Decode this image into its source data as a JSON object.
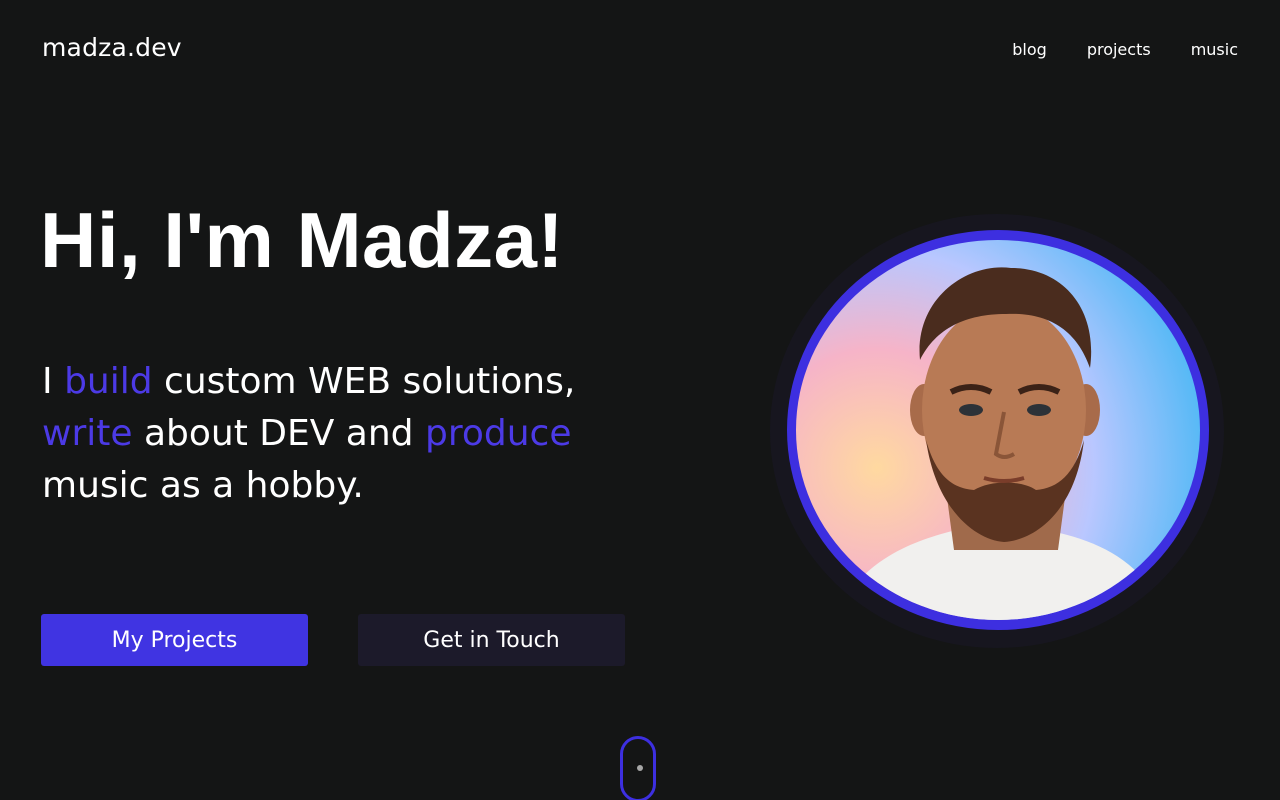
{
  "header": {
    "logo": "madza.dev",
    "nav": [
      {
        "label": "blog"
      },
      {
        "label": "projects"
      },
      {
        "label": "music"
      }
    ]
  },
  "hero": {
    "title": "Hi, I'm Madza!",
    "text": {
      "part1": "I ",
      "highlight1": "build",
      "part2": " custom WEB solutions, ",
      "highlight2": "write",
      "part3": " about DEV and ",
      "highlight3": "produce",
      "part4": " music as a hobby."
    },
    "buttons": {
      "primary": "My Projects",
      "secondary": "Get in Touch"
    }
  },
  "colors": {
    "background": "#141515",
    "accent": "#4034e2",
    "secondary_button": "#1c1a2a"
  },
  "icons": {
    "scroll": "mouse-scroll-icon"
  }
}
